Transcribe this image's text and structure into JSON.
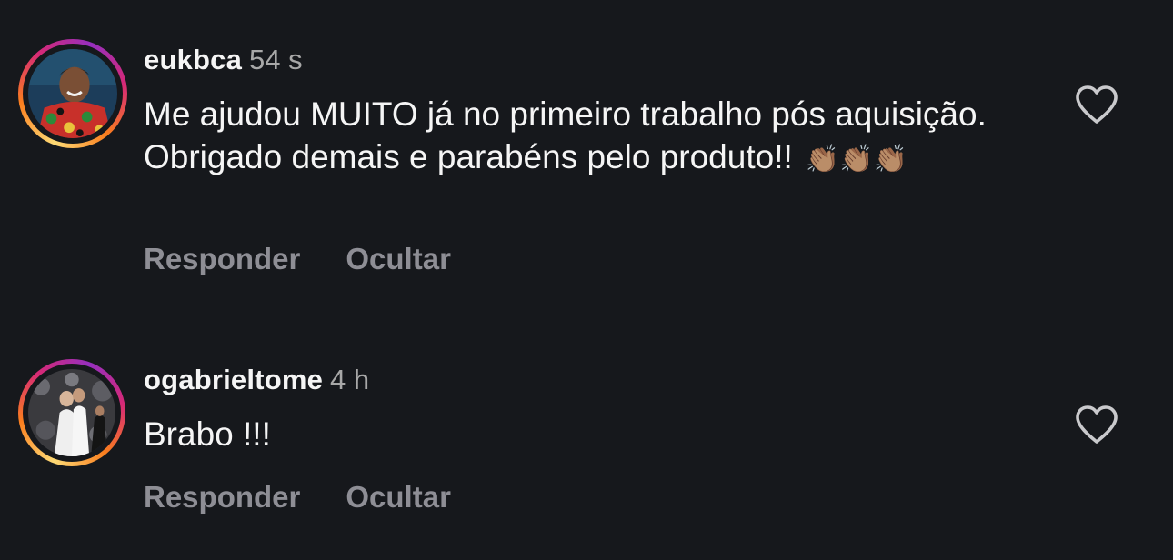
{
  "comments": [
    {
      "username": "eukbca",
      "time": "54 s",
      "text": "Me ajudou MUITO já no primeiro trabalho pós aquisição. Obrigado demais e parabéns pelo produto!!",
      "emoji": "👏🏽👏🏽👏🏽",
      "reply_label": "Responder",
      "hide_label": "Ocultar"
    },
    {
      "username": "ogabrieltome",
      "time": "4 h",
      "text": "Brabo !!!",
      "reply_label": "Responder",
      "hide_label": "Ocultar"
    }
  ],
  "icons": {
    "like": "heart-outline-icon"
  },
  "colors": {
    "background": "#16181c",
    "text": "#f5f5f5",
    "muted": "#8e8e95"
  }
}
